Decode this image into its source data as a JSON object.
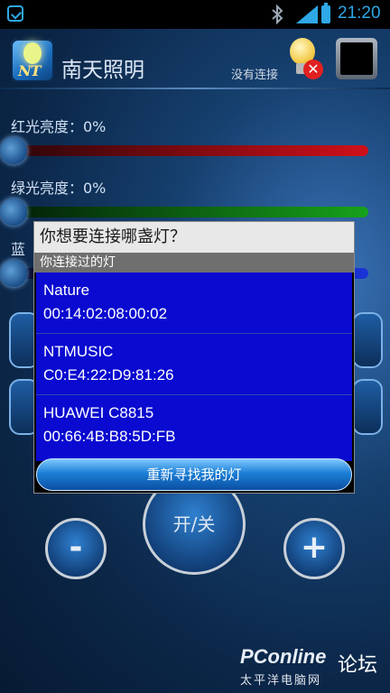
{
  "status_bar": {
    "time": "21:20",
    "icons": [
      "app-notification-icon",
      "bluetooth-icon",
      "signal-icon",
      "battery-icon"
    ]
  },
  "header": {
    "logo_text": "NT",
    "title": "南天照明",
    "connection_status": "没有连接",
    "icons": [
      "bulb-disconnected-icon",
      "black-square-button"
    ]
  },
  "sliders": {
    "red": {
      "label": "红光亮度：0%",
      "value": 0,
      "color": "#d0101a"
    },
    "green": {
      "label": "绿光亮度：0%",
      "value": 0,
      "color": "#17a21a"
    },
    "blue": {
      "label": "蓝",
      "value": 0,
      "color": "#1a33d8"
    }
  },
  "dialog": {
    "title": "你想要连接哪盏灯？",
    "subtitle": "你连接过的灯",
    "devices": [
      {
        "name": "Nature",
        "address": "00:14:02:08:00:02"
      },
      {
        "name": "NTMUSIC",
        "address": "C0:E4:22:D9:81:26"
      },
      {
        "name": "HUAWEI C8815",
        "address": "00:66:4B:B8:5D:FB"
      }
    ],
    "rescan_label": "重新寻找我的灯"
  },
  "controls": {
    "power_label": "开/关",
    "minus_label": "-",
    "plus_label": "+"
  },
  "watermark": {
    "brand": "PConline",
    "forum": "论坛",
    "sub": "太平洋电脑网"
  }
}
